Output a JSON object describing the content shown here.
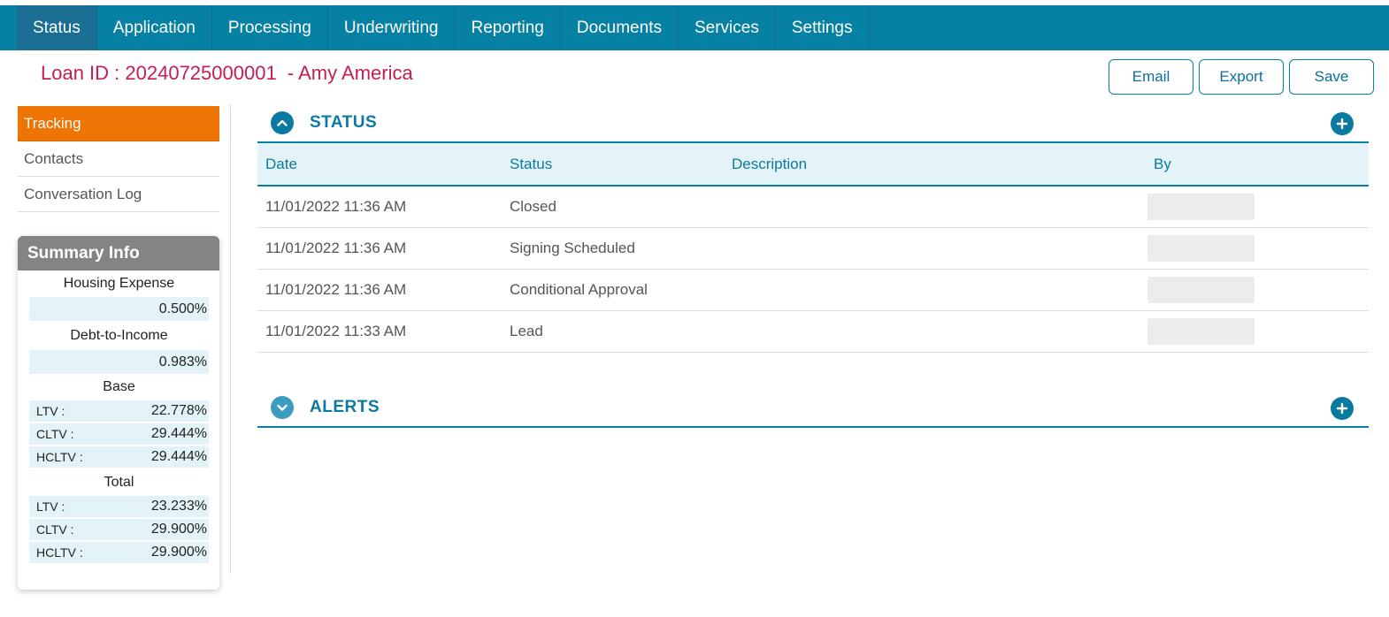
{
  "nav": {
    "tabs": [
      {
        "label": "Status"
      },
      {
        "label": "Application"
      },
      {
        "label": "Processing"
      },
      {
        "label": "Underwriting"
      },
      {
        "label": "Reporting"
      },
      {
        "label": "Documents"
      },
      {
        "label": "Services"
      },
      {
        "label": "Settings"
      }
    ]
  },
  "loan": {
    "title": "Loan ID : 20240725000001  - Amy America"
  },
  "actions": {
    "email_label": "Email",
    "export_label": "Export",
    "save_label": "Save"
  },
  "sidebar": {
    "items": [
      {
        "label": "Tracking"
      },
      {
        "label": "Contacts"
      },
      {
        "label": "Conversation Log"
      }
    ]
  },
  "summary": {
    "title": "Summary Info",
    "housing_expense_label": "Housing Expense",
    "housing_expense_value": "0.500%",
    "dti_label": "Debt-to-Income",
    "dti_value": "0.983%",
    "base_label": "Base",
    "base": [
      {
        "label": "LTV :",
        "value": "22.778%"
      },
      {
        "label": "CLTV :",
        "value": "29.444%"
      },
      {
        "label": "HCLTV :",
        "value": "29.444%"
      }
    ],
    "total_label": "Total",
    "total": [
      {
        "label": "LTV :",
        "value": "23.233%"
      },
      {
        "label": "CLTV :",
        "value": "29.900%"
      },
      {
        "label": "HCLTV :",
        "value": "29.900%"
      }
    ]
  },
  "status_panel": {
    "title": "STATUS",
    "columns": {
      "date": "Date",
      "status": "Status",
      "description": "Description",
      "by": "By"
    },
    "rows": [
      {
        "date": "11/01/2022 11:36 AM",
        "status": "Closed",
        "description": ""
      },
      {
        "date": "11/01/2022 11:36 AM",
        "status": "Signing Scheduled",
        "description": ""
      },
      {
        "date": "11/01/2022 11:36 AM",
        "status": "Conditional Approval",
        "description": ""
      },
      {
        "date": "11/01/2022 11:33 AM",
        "status": "Lead",
        "description": ""
      }
    ]
  },
  "alerts_panel": {
    "title": "ALERTS"
  },
  "colors": {
    "nav_bg": "#0781a3",
    "accent_orange": "#ee7406",
    "title_red": "#c41e50",
    "header_blue": "#0a7aa1",
    "row_tint": "#e3f3f7"
  },
  "icons": {
    "status_toggle": "chevron-up-icon",
    "alerts_toggle": "chevron-down-icon",
    "add": "plus-icon"
  }
}
